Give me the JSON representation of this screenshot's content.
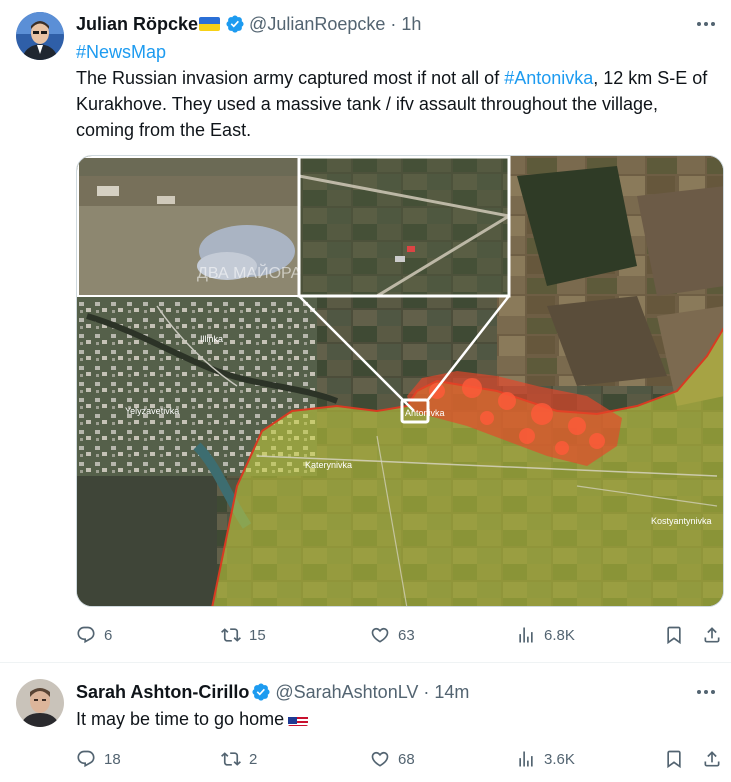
{
  "tweets": [
    {
      "author_name": "Julian Röpcke",
      "handle": "@JulianRoepcke",
      "dot": "·",
      "time": "1h",
      "hashtag": "#NewsMap",
      "text_part1": "The Russian invasion army captured most if not all of ",
      "text_link": "#Antonivka",
      "text_part2": ", 12 km S-E of Kurakhove. They used a massive tank / ifv assault throughout the village, coming from the East.",
      "media": {
        "watermark": "ДВА МАЙОРА",
        "places": {
          "illinka": "Illinka",
          "yelyzavetivka": "Yelyzavetivka",
          "antonivka": "Antonivka",
          "katerynivka": "Katerynivka",
          "kostyantynivka": "Kostyantynivka"
        }
      },
      "stats": {
        "replies": "6",
        "reposts": "15",
        "likes": "63",
        "views": "6.8K"
      }
    },
    {
      "author_name": "Sarah Ashton-Cirillo",
      "handle": "@SarahAshtonLV",
      "dot": "·",
      "time": "14m",
      "text": "It may be time to go home",
      "stats": {
        "replies": "18",
        "reposts": "2",
        "likes": "68",
        "views": "3.6K"
      }
    }
  ],
  "colors": {
    "link": "#1d9bf0",
    "secondary_text": "#536471",
    "verified": "#1d9bf0",
    "map_control_zone": "#c8d23a",
    "map_captured_zone": "#e8452a",
    "map_border": "#d83a22"
  },
  "icons": [
    "verified-badge-icon",
    "more-icon",
    "reply-icon",
    "repost-icon",
    "like-icon",
    "views-icon",
    "bookmark-icon",
    "share-icon",
    "ukraine-flag-icon",
    "us-flag-icon"
  ]
}
